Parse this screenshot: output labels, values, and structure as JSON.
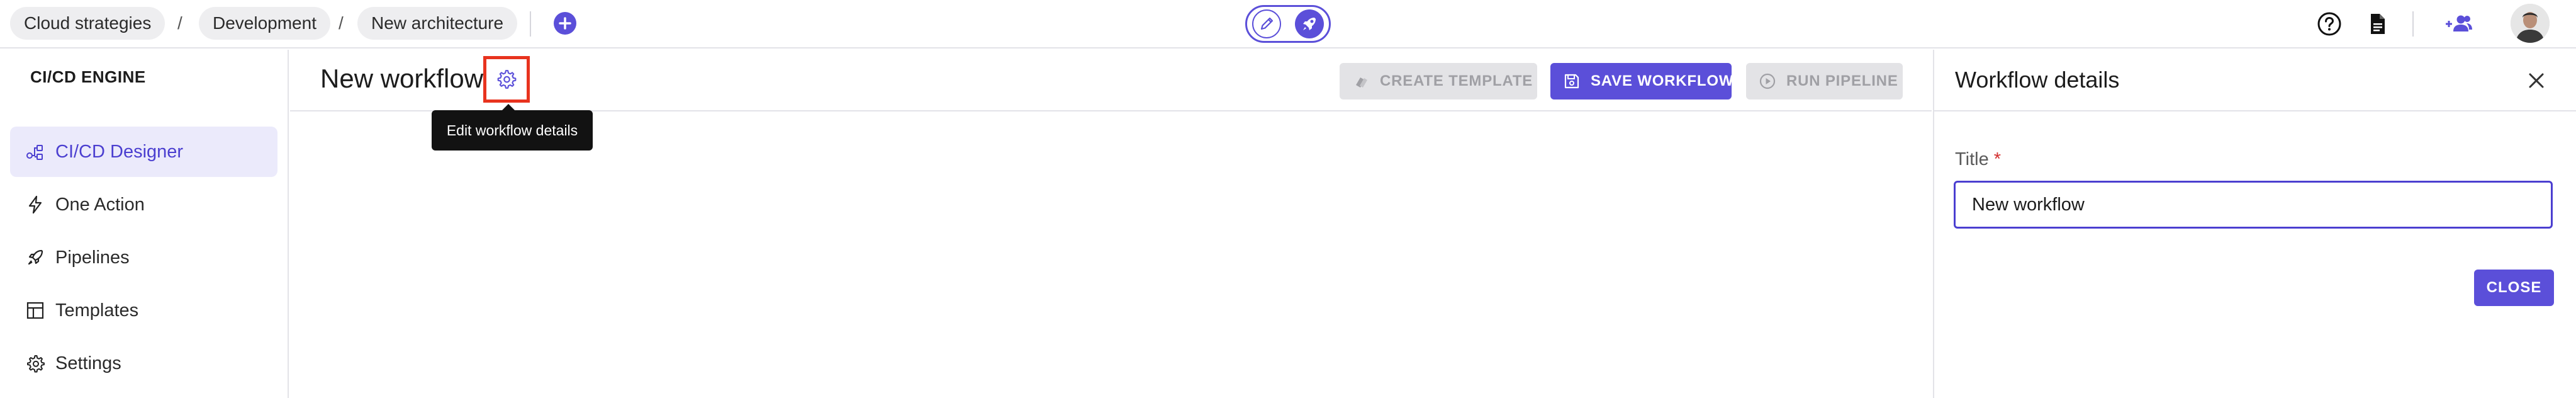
{
  "breadcrumb": {
    "items": [
      {
        "label": "Cloud strategies"
      },
      {
        "label": "Development"
      },
      {
        "label": "New architecture"
      }
    ],
    "separator": "/"
  },
  "mode_switch": {
    "edit_icon": "pencil-icon",
    "run_icon": "rocket-icon"
  },
  "top_icons": [
    "help-icon",
    "document-icon",
    "people-icon",
    "avatar"
  ],
  "sidebar": {
    "app_title": "CI/CD ENGINE",
    "items": [
      {
        "label": "CI/CD Designer",
        "icon": "designer-icon",
        "active": true
      },
      {
        "label": "One Action",
        "icon": "bolt-icon",
        "active": false
      },
      {
        "label": "Pipelines",
        "icon": "rocket-icon",
        "active": false
      },
      {
        "label": "Templates",
        "icon": "template-icon",
        "active": false
      },
      {
        "label": "Settings",
        "icon": "gear-icon",
        "active": false
      }
    ]
  },
  "main": {
    "title": "New workflow",
    "tooltip": "Edit workflow details",
    "buttons": {
      "create_template": "CREATE TEMPLATE",
      "save_workflow": "SAVE WORKFLOW",
      "run_pipeline": "RUN PIPELINE"
    }
  },
  "panel": {
    "title": "Workflow details",
    "field_label": "Title",
    "required_mark": "*",
    "field_value": "New workflow",
    "close_button": "CLOSE"
  },
  "colors": {
    "accent": "#5b4fd9",
    "highlight_box": "#e8331e",
    "active_nav_bg": "#ebeafb"
  }
}
